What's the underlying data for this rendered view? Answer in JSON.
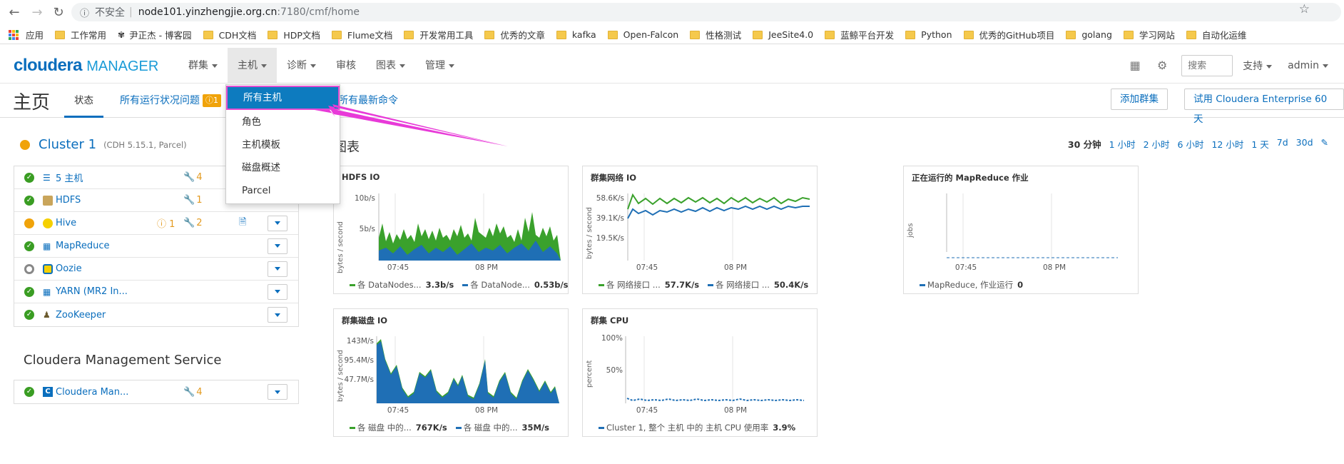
{
  "browser": {
    "insecure_label": "不安全",
    "url_host": "node101.yinzhengjie.org.cn",
    "url_path": ":7180/cmf/home",
    "bookmarks": [
      "应用",
      "工作常用",
      "尹正杰 - 博客园",
      "CDH文档",
      "HDP文档",
      "Flume文档",
      "开发常用工具",
      "优秀的文章",
      "kafka",
      "Open-Falcon",
      "性格测试",
      "JeeSite4.0",
      "蓝鲸平台开发",
      "Python",
      "优秀的GitHub项目",
      "golang",
      "学习网站",
      "自动化运维"
    ]
  },
  "header": {
    "logo_main": "cloudera",
    "logo_sub": "MANAGER",
    "nav": [
      "群集",
      "主机",
      "诊断",
      "审核",
      "图表",
      "管理"
    ],
    "search_placeholder": "搜索",
    "support": "支持",
    "user": "admin"
  },
  "titlebar": {
    "title": "主页",
    "tab_status": "状态",
    "tab_health": "所有运行状况问题",
    "health_count": "1",
    "tab_commands": "所有最新命令",
    "add_cluster": "添加群集",
    "trial": "试用 Cloudera Enterprise 60 天"
  },
  "cluster": {
    "name": "Cluster 1",
    "sub": "(CDH 5.15.1, Parcel)",
    "services": [
      {
        "name": "5 主机",
        "wrench": "4",
        "alert": "",
        "status": "ok"
      },
      {
        "name": "HDFS",
        "wrench": "1",
        "alert": "",
        "status": "ok"
      },
      {
        "name": "Hive",
        "wrench": "2",
        "alert": "1",
        "status": "warn"
      },
      {
        "name": "MapReduce",
        "wrench": "",
        "alert": "",
        "status": "ok"
      },
      {
        "name": "Oozie",
        "wrench": "",
        "alert": "",
        "status": "grey"
      },
      {
        "name": "YARN (MR2 In...",
        "wrench": "",
        "alert": "",
        "status": "ok"
      },
      {
        "name": "ZooKeeper",
        "wrench": "",
        "alert": "",
        "status": "ok"
      }
    ]
  },
  "mgmt": {
    "title": "Cloudera Management Service",
    "service": "Cloudera Man...",
    "wrench": "4"
  },
  "charts": {
    "title": "图表",
    "ranges": [
      "30 分钟",
      "1 小时",
      "2 小时",
      "6 小时",
      "12 小时",
      "1 天",
      "7d",
      "30d"
    ],
    "hdfs": {
      "title": "HDFS IO",
      "ylabel": "bytes / second",
      "yticks": [
        "10b/s",
        "5b/s"
      ],
      "xticks": [
        "07:45",
        "08 PM"
      ],
      "l1": "各 DataNodes...",
      "v1": "3.3b/s",
      "l2": "各 DataNode...",
      "v2": "0.53b/s"
    },
    "net": {
      "title": "群集网络 IO",
      "ylabel": "bytes / second",
      "yticks": [
        "58.6K/s",
        "39.1K/s",
        "19.5K/s"
      ],
      "xticks": [
        "07:45",
        "08 PM"
      ],
      "l1": "各 网络接口 ...",
      "v1": "57.7K/s",
      "l2": "各 网络接口 ...",
      "v2": "50.4K/s"
    },
    "mr": {
      "title": "正在运行的 MapReduce 作业",
      "ylabel": "jobs",
      "xticks": [
        "07:45",
        "08 PM"
      ],
      "l1": "MapReduce, 作业运行",
      "v1": "0"
    },
    "disk": {
      "title": "群集磁盘 IO",
      "ylabel": "bytes / second",
      "yticks": [
        "143M/s",
        "95.4M/s",
        "47.7M/s"
      ],
      "xticks": [
        "07:45",
        "08 PM"
      ],
      "l1": "各 磁盘 中的...",
      "v1": "767K/s",
      "l2": "各 磁盘 中的...",
      "v2": "35M/s"
    },
    "cpu": {
      "title": "群集 CPU",
      "ylabel": "percent",
      "yticks": [
        "100%",
        "50%"
      ],
      "xticks": [
        "07:45",
        "08 PM"
      ],
      "l1": "Cluster 1, 整个 主机 中的 主机 CPU 使用率",
      "v1": "3.9%"
    }
  },
  "dropdown": {
    "items": [
      "所有主机",
      "角色",
      "主机模板",
      "磁盘概述",
      "Parcel"
    ]
  },
  "colors": {
    "accent": "#0a6ebd",
    "green": "#3a9d23",
    "blue": "#1f6fb5",
    "warn": "#f0a30a",
    "arrow": "#e83ad8"
  }
}
